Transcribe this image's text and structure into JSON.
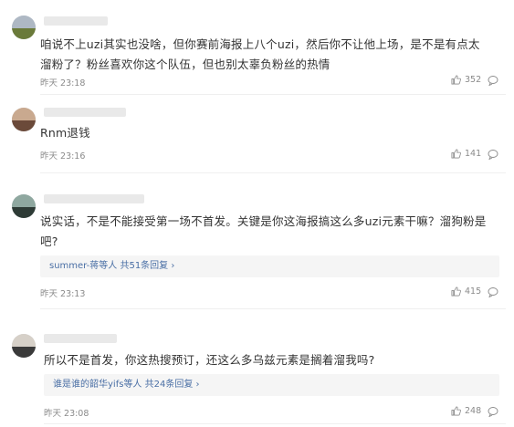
{
  "comments": [
    {
      "text": "咱说不上uzi其实也没啥，但你赛前海报上八个uzi，然后你不让他上场，是不是有点太\n溜粉了？粉丝喜欢你这个队伍，但也别太辜负粉丝的热情",
      "time": "昨天 23:18",
      "likes": "352"
    },
    {
      "text": "Rnm退钱",
      "time": "昨天 23:16",
      "likes": "141"
    },
    {
      "text": "说实话，不是不能接受第一场不首发。关键是你这海报搞这么多uzi元素干嘛？溜狗粉是\n吧?",
      "time": "昨天 23:13",
      "likes": "415",
      "replies": {
        "names": "summer-蒋",
        "suffix": "等人",
        "count": "共51条回复",
        "chevron": "›"
      }
    },
    {
      "text": "所以不是首发，你这热搜预订，还这么多乌兹元素是搁着溜我吗?",
      "time": "昨天 23:08",
      "likes": "248",
      "replies": {
        "names": "谁是谁的韶华yifs",
        "suffix": "等人",
        "count": "共24条回复",
        "chevron": "›"
      }
    }
  ],
  "colors": {
    "link": "#4a6fa5",
    "meta": "#8a8a8a",
    "text": "#333333"
  }
}
